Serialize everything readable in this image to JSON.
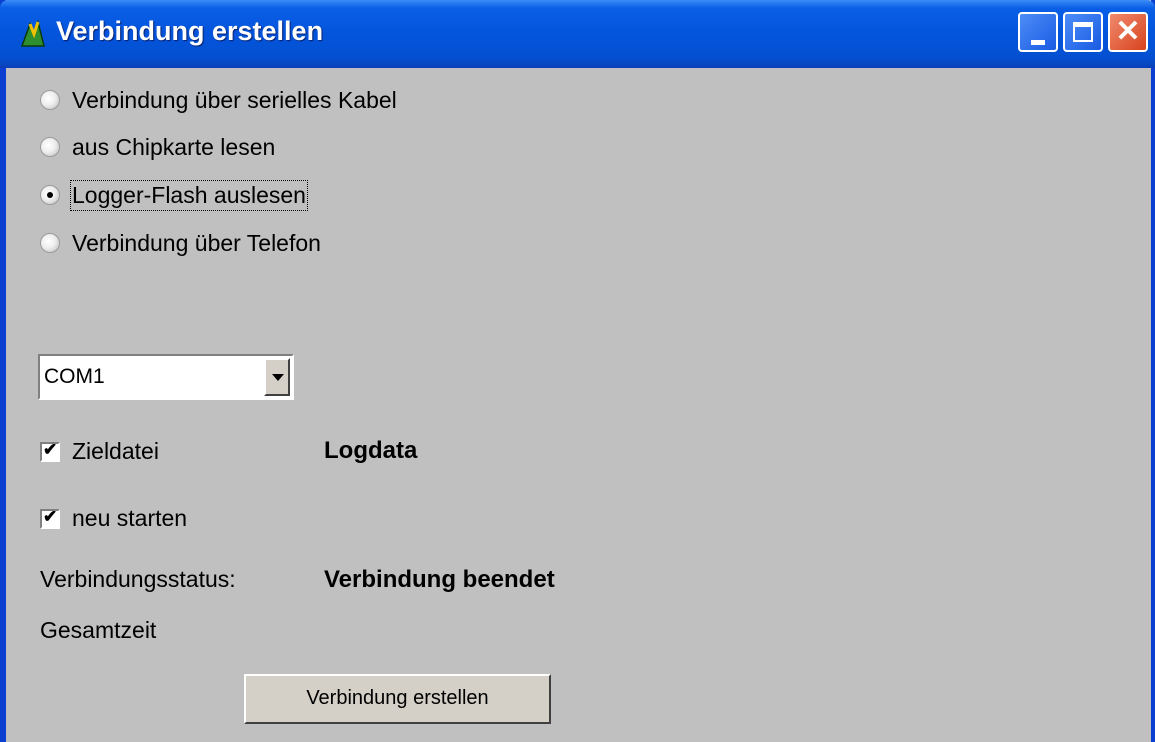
{
  "window": {
    "title": "Verbindung erstellen",
    "controls": {
      "minimize": "minimize-icon",
      "maximize": "maximize-icon",
      "close": "close-icon"
    }
  },
  "options": [
    {
      "label": "Verbindung über serielles Kabel",
      "checked": false
    },
    {
      "label": "aus Chipkarte lesen",
      "checked": false
    },
    {
      "label": "Logger-Flash auslesen",
      "checked": true
    },
    {
      "label": "Verbindung über Telefon",
      "checked": false
    }
  ],
  "port": {
    "value": "COM1"
  },
  "target_file": {
    "label": "Zieldatei",
    "checked": true,
    "value": "Logdata"
  },
  "restart": {
    "label": "neu starten",
    "checked": true
  },
  "status": {
    "label": "Verbindungsstatus:",
    "value": "Verbindung beendet"
  },
  "total_time": {
    "label": "Gesamtzeit"
  },
  "connect_button": {
    "label": "Verbindung erstellen"
  },
  "colors": {
    "titlebar": "#0454dc",
    "face": "#c0c0c0",
    "close": "#d8431d"
  }
}
